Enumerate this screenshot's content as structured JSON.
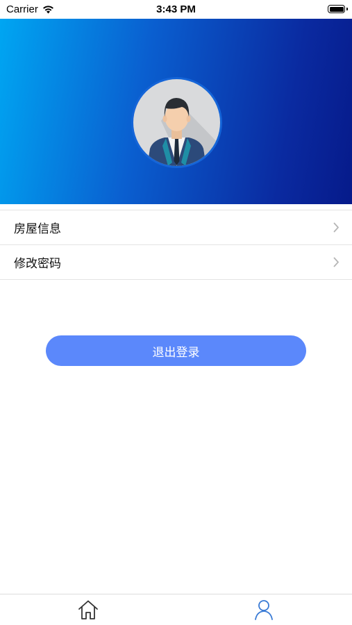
{
  "status_bar": {
    "carrier": "Carrier",
    "time": "3:43 PM",
    "battery_level": 1.0
  },
  "header": {
    "avatar_icon": "businessman-avatar-icon",
    "gradient_colors": [
      "#00a6f2",
      "#061a8a"
    ]
  },
  "menu": {
    "items": [
      {
        "label": "房屋信息",
        "icon": "chevron-right-icon"
      },
      {
        "label": "修改密码",
        "icon": "chevron-right-icon"
      }
    ]
  },
  "logout": {
    "label": "退出登录",
    "color": "#5b88fb"
  },
  "tab_bar": {
    "tabs": [
      {
        "icon": "home-icon",
        "active": false,
        "color": "#333333"
      },
      {
        "icon": "person-icon",
        "active": true,
        "color": "#3a7bd5"
      }
    ]
  }
}
